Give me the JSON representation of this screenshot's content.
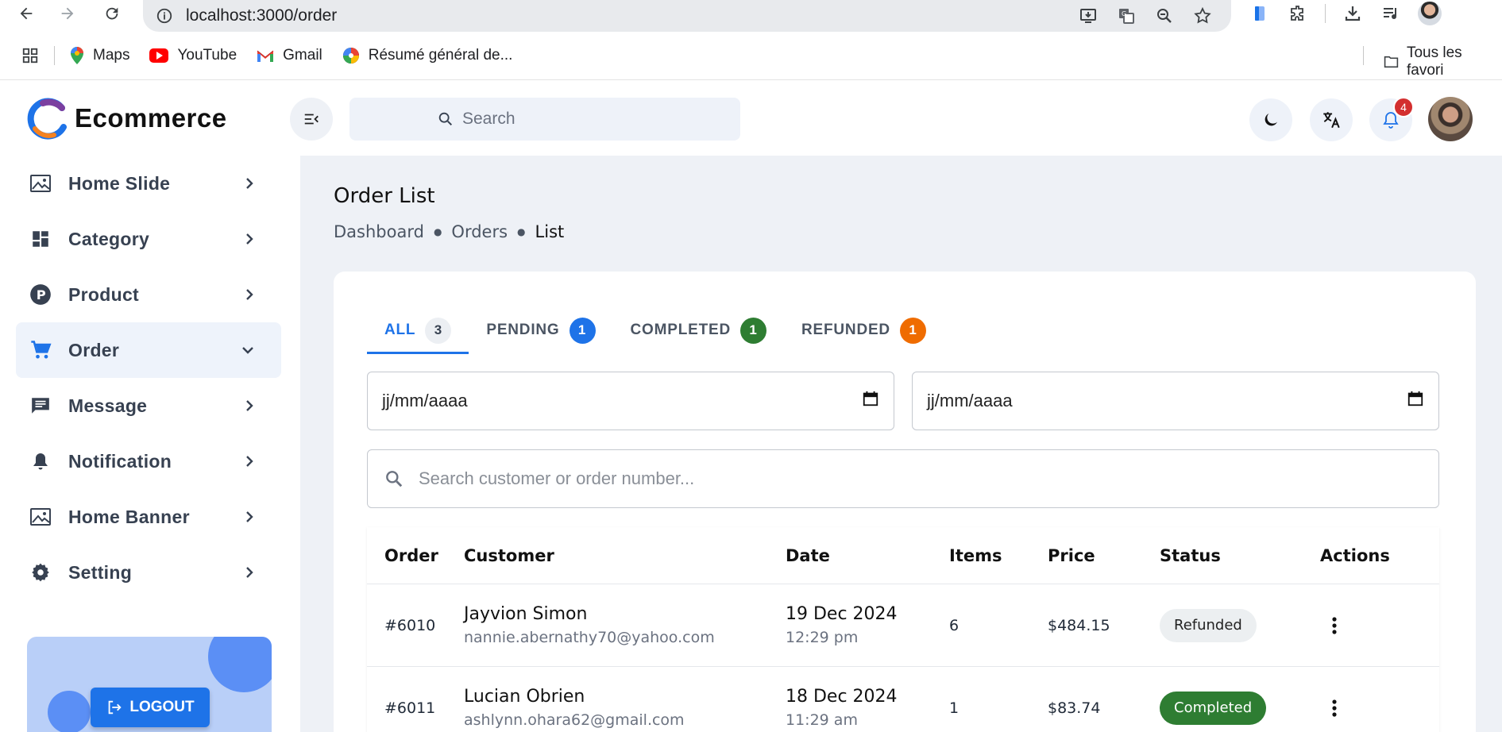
{
  "browser": {
    "url": "localhost:3000/order",
    "bookmarks": [
      {
        "label": "Maps"
      },
      {
        "label": "YouTube"
      },
      {
        "label": "Gmail"
      },
      {
        "label": "Résumé général de..."
      }
    ],
    "all_bookmarks_label": "Tous les favori"
  },
  "header": {
    "logo_text": "Ecommerce",
    "search_placeholder": "Search",
    "notification_count": "4"
  },
  "sidebar": {
    "items": [
      {
        "label": "Home Slide",
        "icon": "image-icon"
      },
      {
        "label": "Category",
        "icon": "dashboard-icon"
      },
      {
        "label": "Product",
        "icon": "product-p-icon"
      },
      {
        "label": "Order",
        "icon": "cart-icon",
        "active": true
      },
      {
        "label": "Message",
        "icon": "message-icon"
      },
      {
        "label": "Notification",
        "icon": "bell-icon"
      },
      {
        "label": "Home Banner",
        "icon": "image-icon"
      },
      {
        "label": "Setting",
        "icon": "gear-icon"
      }
    ],
    "logout_label": "LOGOUT"
  },
  "main": {
    "title": "Order List",
    "breadcrumb": [
      "Dashboard",
      "Orders",
      "List"
    ],
    "tabs": [
      {
        "label": "ALL",
        "count": "3",
        "color": "#eceff3",
        "text_color": "#374151"
      },
      {
        "label": "PENDING",
        "count": "1",
        "color": "#1e73e8",
        "text_color": "#ffffff"
      },
      {
        "label": "COMPLETED",
        "count": "1",
        "color": "#2e7d32",
        "text_color": "#ffffff"
      },
      {
        "label": "REFUNDED",
        "count": "1",
        "color": "#ef6c00",
        "text_color": "#ffffff"
      }
    ],
    "start_date_placeholder": "jj/mm/aaaa",
    "end_date_placeholder": "jj/mm/aaaa",
    "search_placeholder": "Search customer or order number...",
    "table": {
      "columns": [
        "Order",
        "Customer",
        "Date",
        "Items",
        "Price",
        "Status",
        "Actions"
      ],
      "rows": [
        {
          "order": "#6010",
          "customer": "Jayvion Simon",
          "email": "nannie.abernathy70@yahoo.com",
          "date": "19 Dec 2024",
          "time": "12:29 pm",
          "items": "6",
          "price": "$484.15",
          "status": "Refunded",
          "status_bg": "#eceff1",
          "status_fg": "#222222"
        },
        {
          "order": "#6011",
          "customer": "Lucian Obrien",
          "email": "ashlynn.ohara62@gmail.com",
          "date": "18 Dec 2024",
          "time": "11:29 am",
          "items": "1",
          "price": "$83.74",
          "status": "Completed",
          "status_bg": "#2e7d32",
          "status_fg": "#ffffff"
        }
      ]
    }
  }
}
